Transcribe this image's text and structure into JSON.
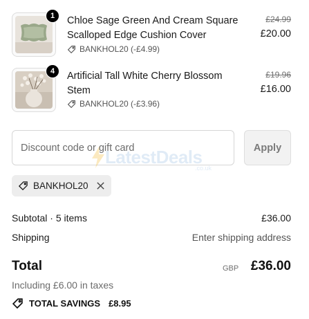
{
  "items": [
    {
      "quantity": "1",
      "title": "Chloe Sage Green And Cream Square Scalloped Edge Cushion Cover",
      "discount": "BANKHOL20 (-£4.99)",
      "original_price": "£24.99",
      "price": "£20.00",
      "image_icon": "cushion-image"
    },
    {
      "quantity": "4",
      "title": "Artificial Tall White Cherry Blossom Stem",
      "discount": "BANKHOL20 (-£3.96)",
      "original_price": "£19.96",
      "price": "£16.00",
      "image_icon": "blossom-vase-image"
    }
  ],
  "discount_form": {
    "placeholder": "Discount code or gift card",
    "apply_label": "Apply"
  },
  "watermark": {
    "text": "LatestDeals",
    "sub": ".co.uk"
  },
  "applied_code": {
    "label": "BANKHOL20",
    "icon": "tag-icon",
    "remove_icon": "close-icon"
  },
  "summary": {
    "subtotal_label": "Subtotal · 5 items",
    "subtotal_value": "£36.00",
    "shipping_label": "Shipping",
    "shipping_value": "Enter shipping address",
    "total_label": "Total",
    "currency": "GBP",
    "total_value": "£36.00",
    "taxes": "Including £6.00 in taxes",
    "savings_label": "TOTAL SAVINGS",
    "savings_value": "£8.95"
  },
  "colors": {
    "text": "#1a1a1a",
    "muted": "#6b6b6b",
    "chip_bg": "#ededed",
    "apply_bg": "#f2f2f2",
    "badge": "#000000"
  }
}
